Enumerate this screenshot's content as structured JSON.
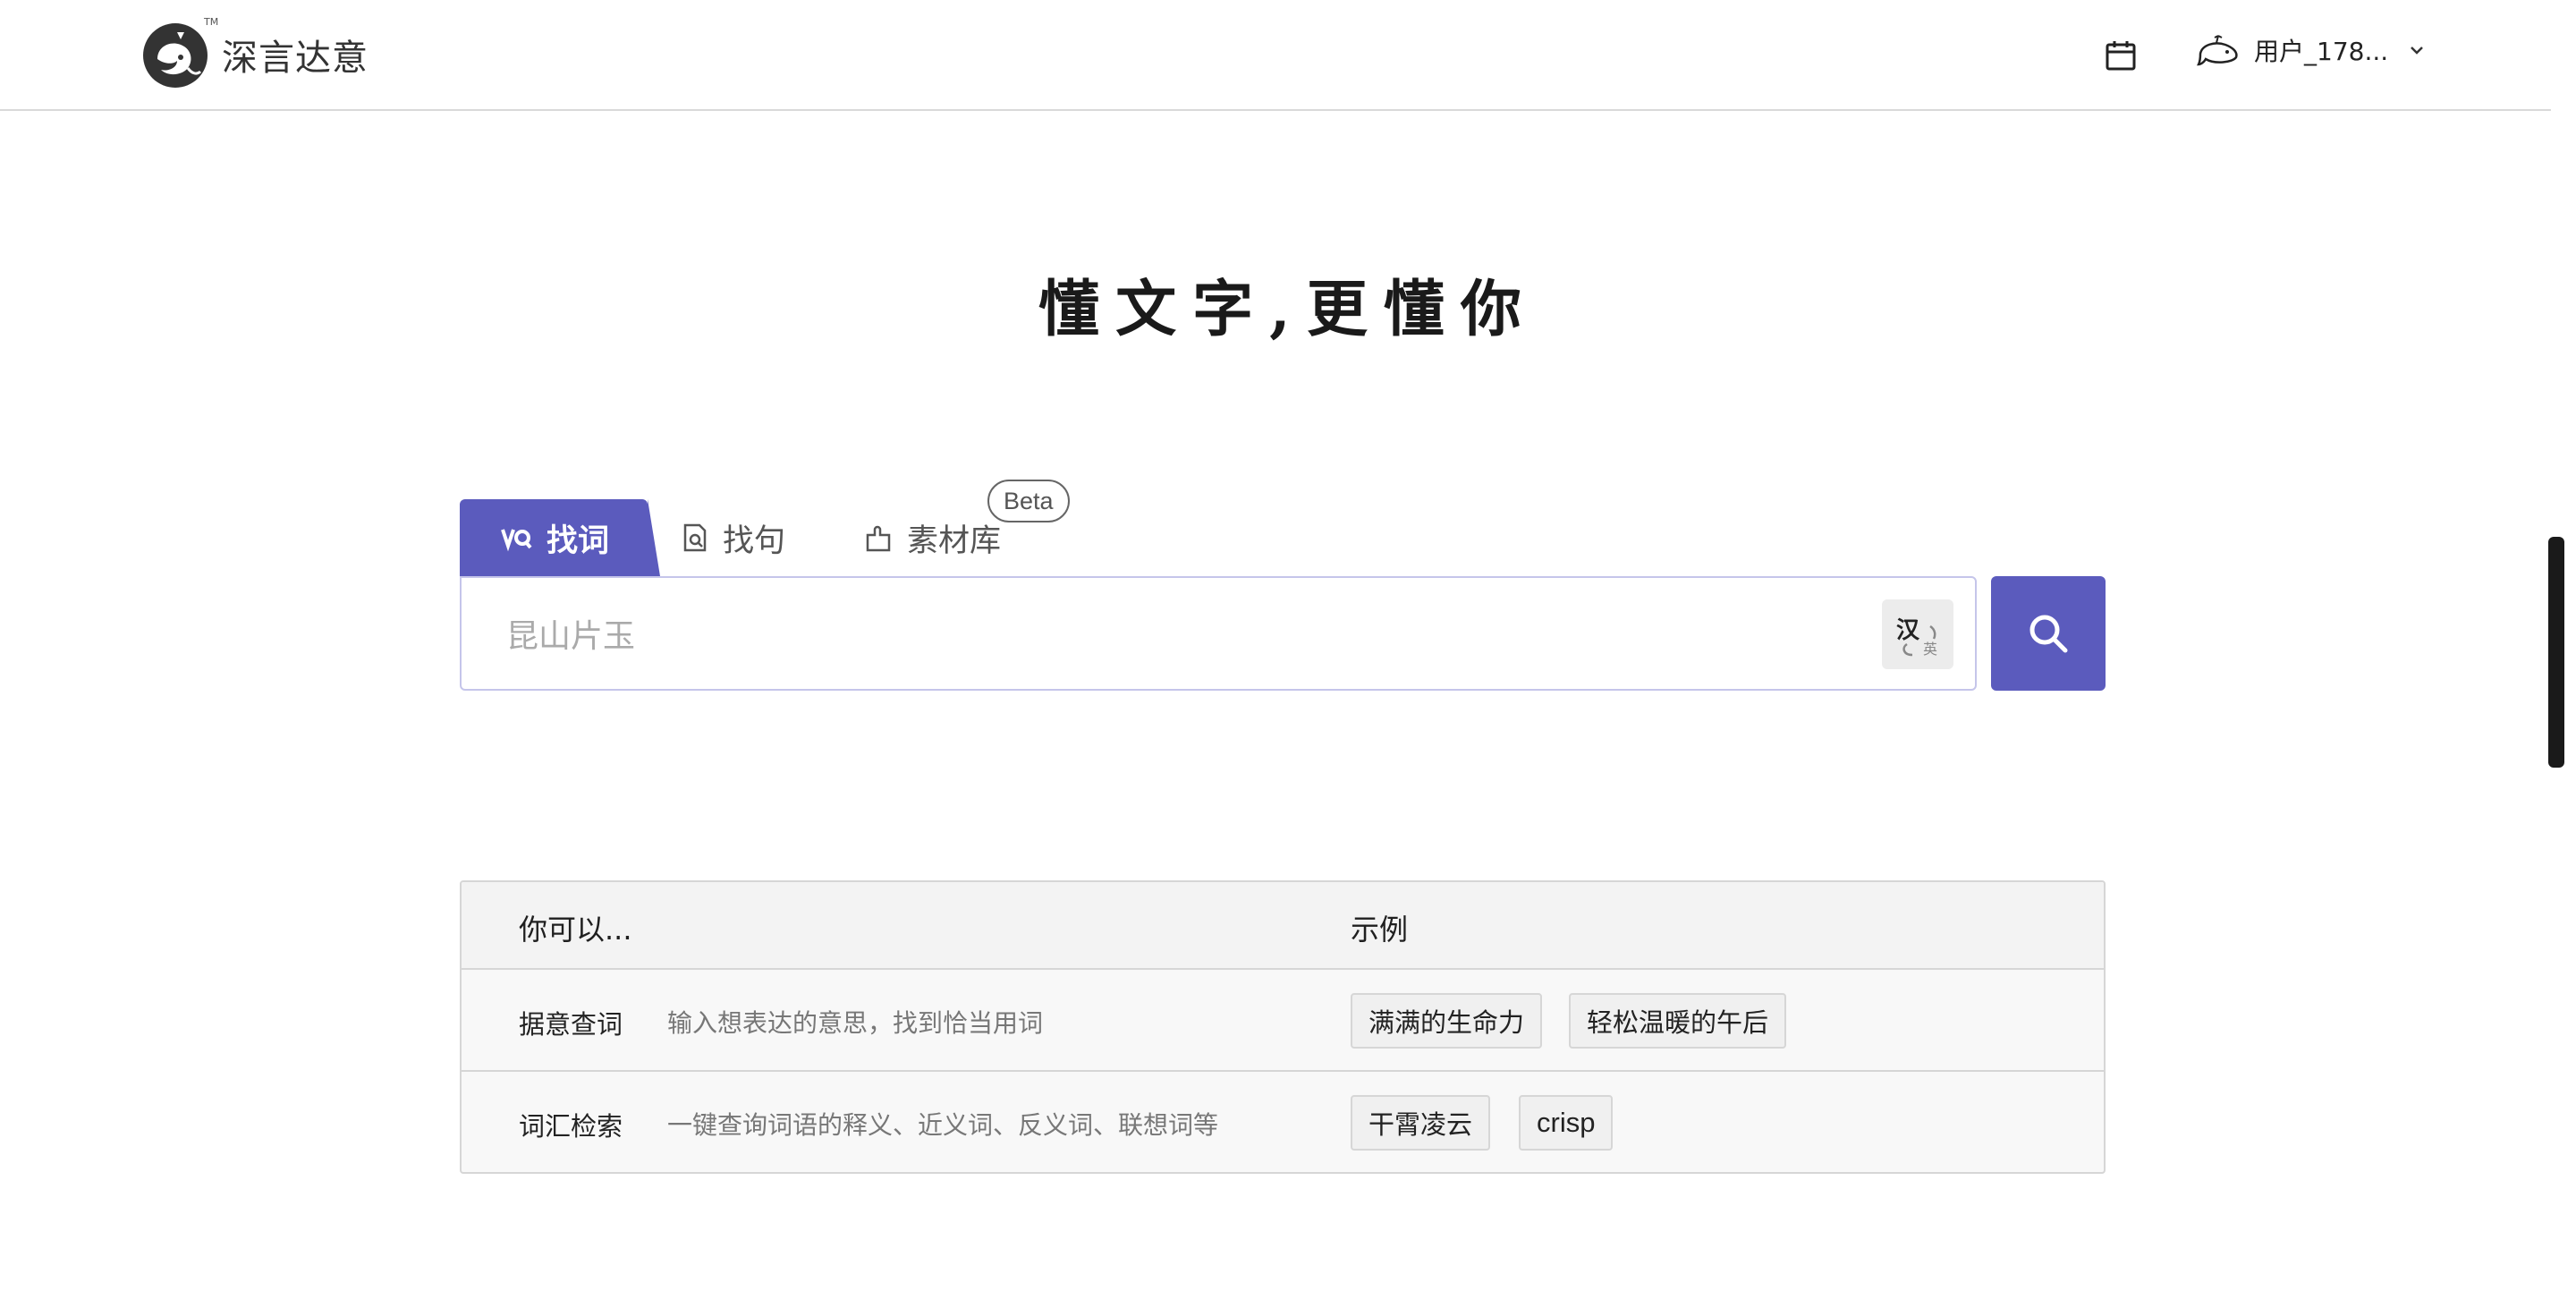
{
  "header": {
    "brand_name": "深言达意",
    "tm": "TM",
    "user_name": "用户_178..."
  },
  "hero": {
    "slogan": "懂文字,更懂你"
  },
  "tabs": [
    {
      "label": "找词",
      "icon": "word-search-icon",
      "active": true
    },
    {
      "label": "找句",
      "icon": "sentence-search-icon",
      "active": false
    },
    {
      "label": "素材库",
      "icon": "puzzle-icon",
      "active": false,
      "badge": "Beta"
    }
  ],
  "search": {
    "placeholder": "昆山片玉",
    "value": "",
    "lang_toggle": {
      "primary": "汉",
      "secondary": "英"
    }
  },
  "guide": {
    "headers": [
      "你可以...",
      "示例"
    ],
    "rows": [
      {
        "label": "据意查词",
        "desc": "输入想表达的意思，找到恰当用词",
        "examples": [
          "满满的生命力",
          "轻松温暖的午后"
        ]
      },
      {
        "label": "词汇检索",
        "desc": "一键查询词语的释义、近义词、反义词、联想词等",
        "examples": [
          "干霄凌云",
          "crisp"
        ]
      }
    ]
  },
  "colors": {
    "accent": "#5b5bbd",
    "border": "#d6d6d6"
  }
}
